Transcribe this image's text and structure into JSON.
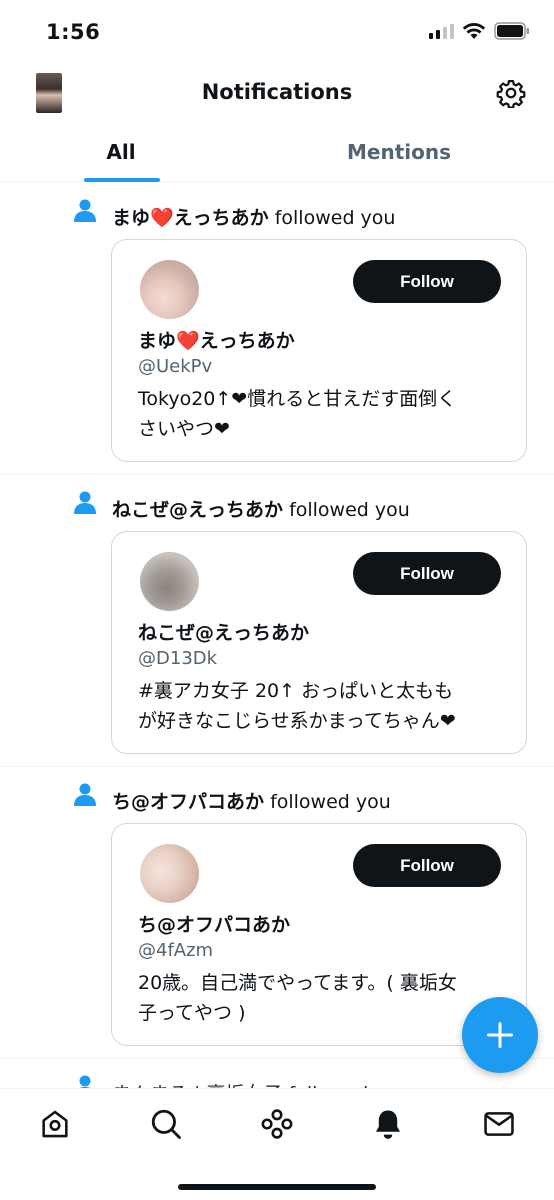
{
  "status_bar": {
    "time": "1:56"
  },
  "header": {
    "title": "Notifications"
  },
  "tabs": [
    {
      "label": "All",
      "active": true
    },
    {
      "label": "Mentions",
      "active": false
    }
  ],
  "notifications": [
    {
      "display_name": "まゆ❤️えっちあか",
      "action": "followed you",
      "follow_label": "Follow",
      "handle": "@UekPv",
      "bio_line1": "Tokyo20↑❤慣れると甘えだす面倒く",
      "bio_line2": "さいやつ❤"
    },
    {
      "display_name": "ねこぜ@えっちあか",
      "action": "followed you",
      "follow_label": "Follow",
      "handle": "@D13Dk",
      "bio_line1": "#裏アカ女子 20↑ おっぱいと太もも",
      "bio_line2": "が好きなこじらせ系かまってちゃん❤"
    },
    {
      "display_name": "ち@オフパコあか",
      "action": "followed you",
      "follow_label": "Follow",
      "handle": "@4fAzm",
      "bio_line1": "20歳。自己満でやってます。( 裏垢女",
      "bio_line2": "子ってやつ )"
    }
  ],
  "partial_notification": {
    "text": "まんまる | 裏垢女子 followed"
  },
  "colors": {
    "accent": "#1d9bf0",
    "text": "#0f1419",
    "muted": "#536471",
    "border": "#cfd9de"
  },
  "icons": [
    "home-icon",
    "search-icon",
    "communities-icon",
    "notifications-bell-icon",
    "messages-icon",
    "settings-gear-icon",
    "compose-plus-icon"
  ]
}
